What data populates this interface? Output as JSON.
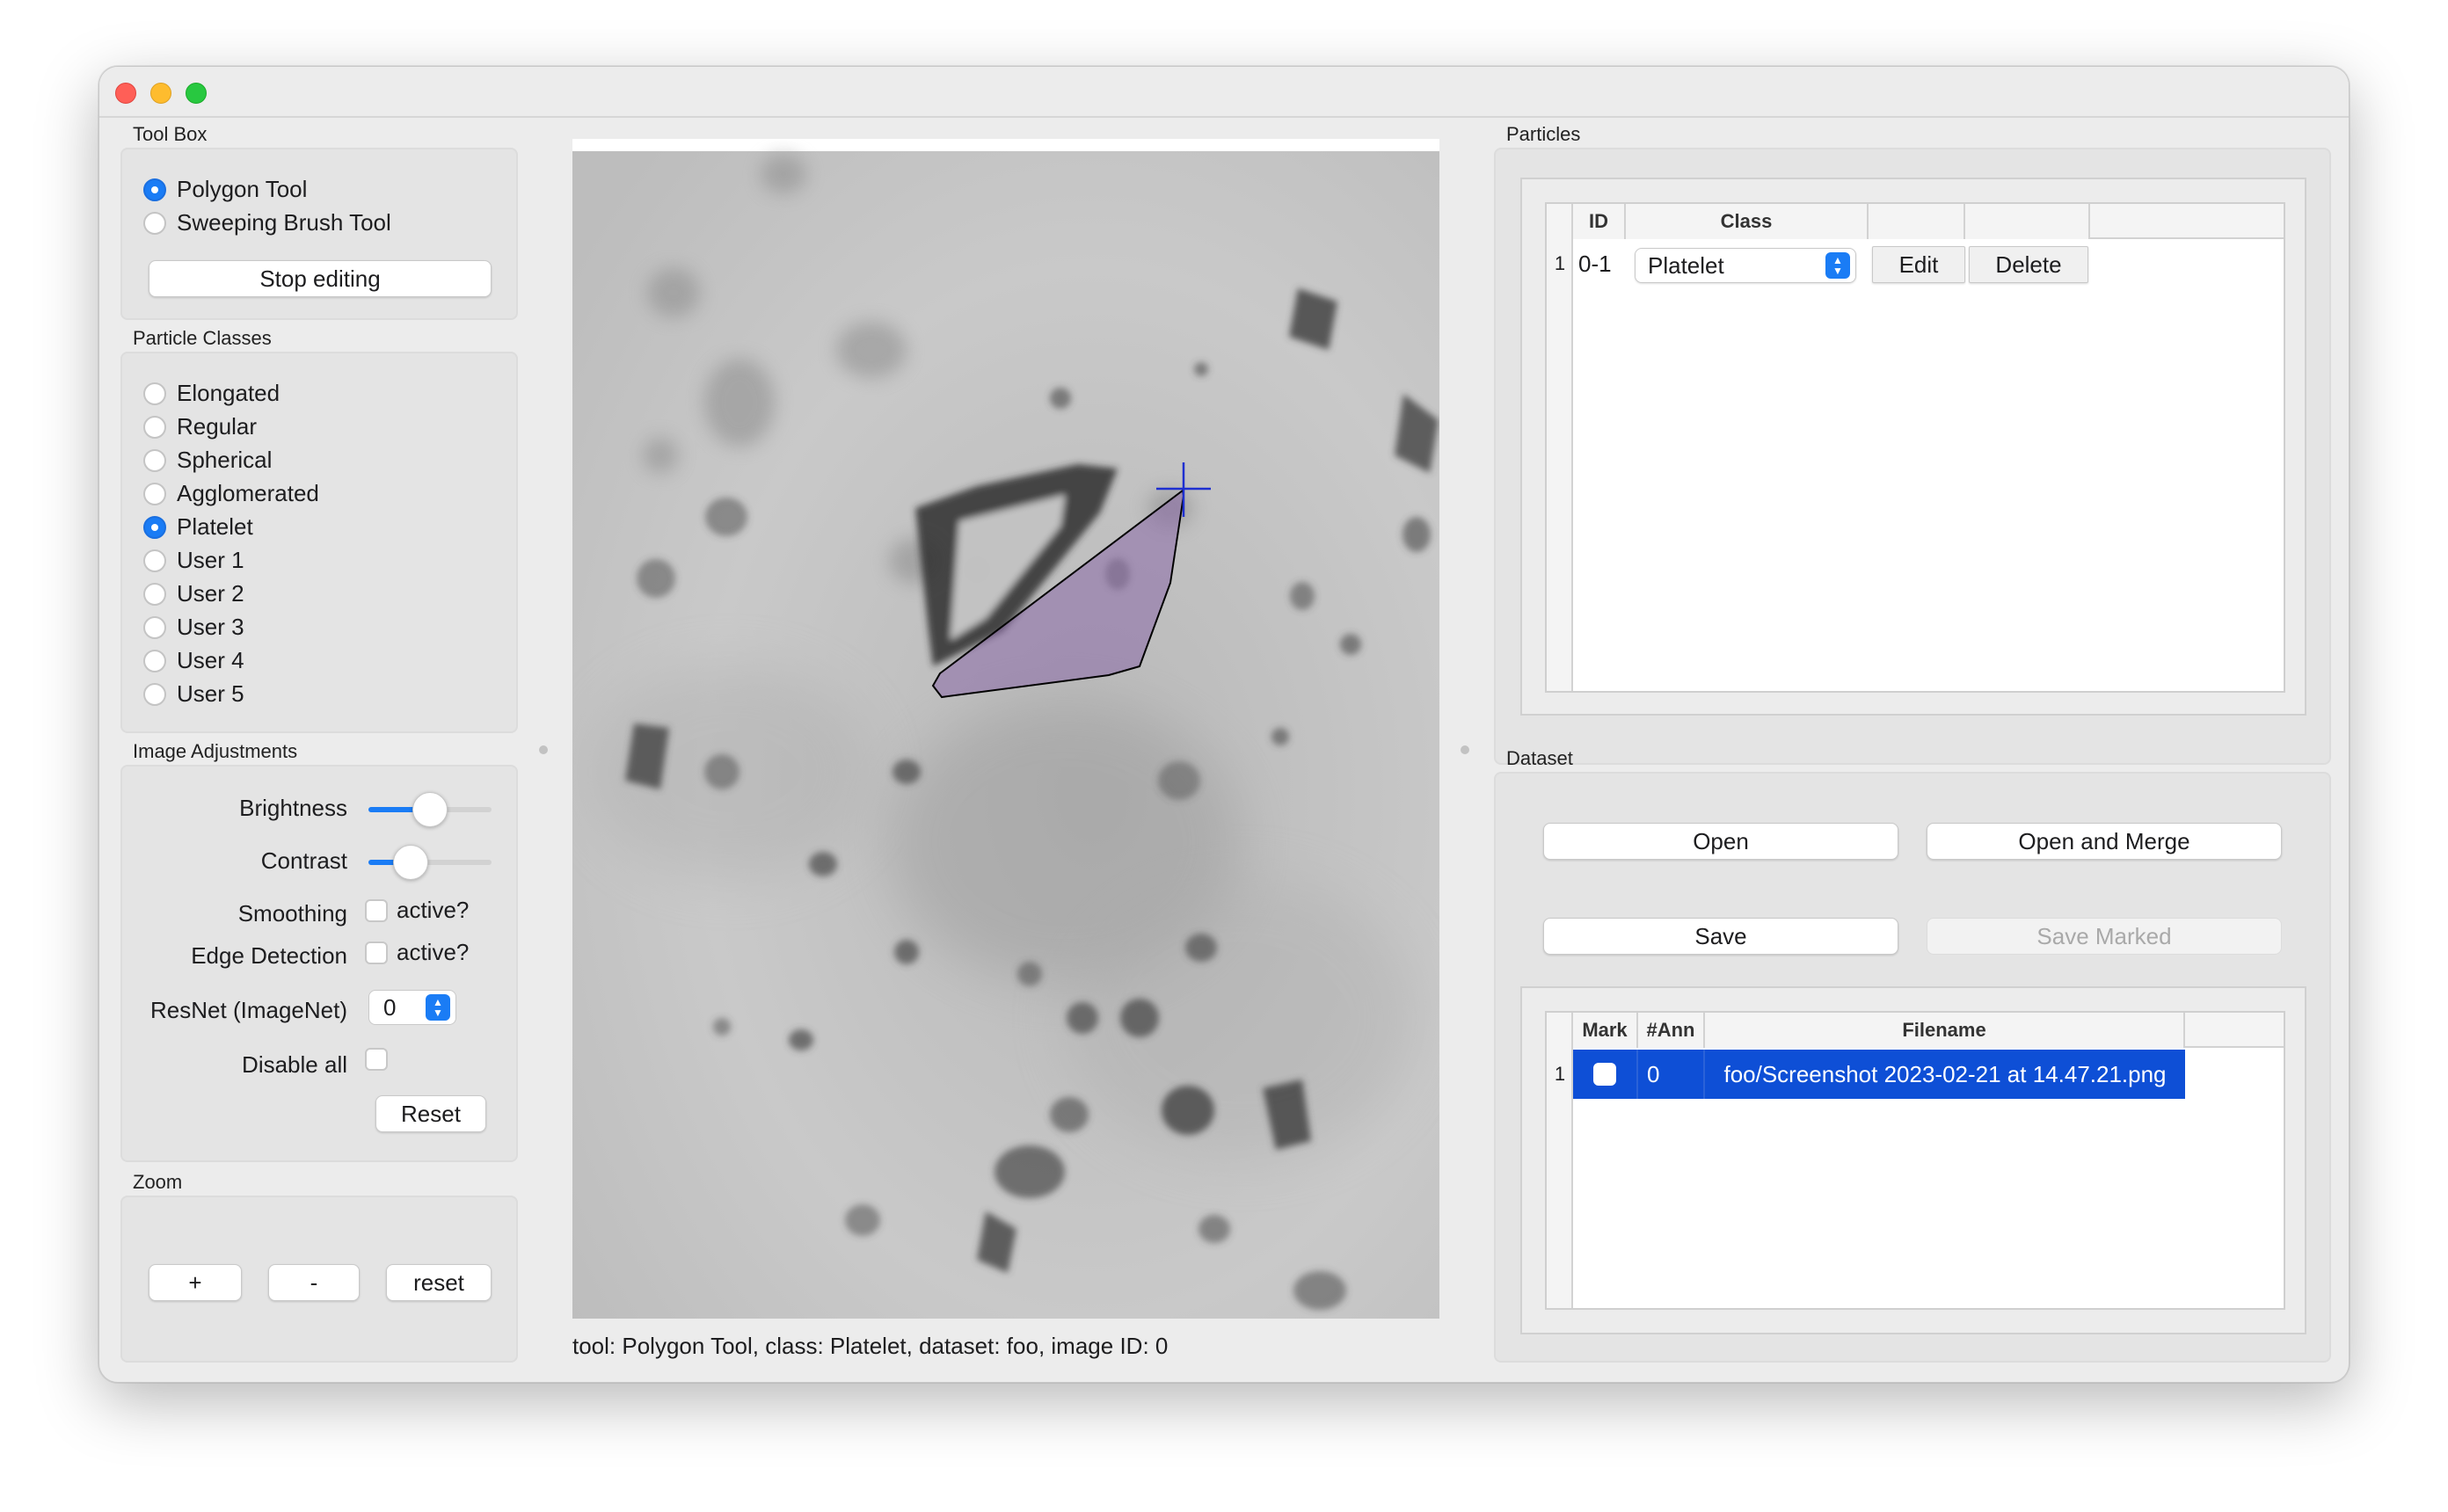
{
  "toolbox": {
    "title": "Tool Box",
    "tools": [
      "Polygon Tool",
      "Sweeping Brush Tool"
    ],
    "selected_tool_index": 0,
    "stop_editing_label": "Stop editing"
  },
  "particle_classes": {
    "title": "Particle Classes",
    "items": [
      "Elongated",
      "Regular",
      "Spherical",
      "Agglomerated",
      "Platelet",
      "User 1",
      "User 2",
      "User 3",
      "User 4",
      "User 5"
    ],
    "selected_index": 4
  },
  "image_adjustments": {
    "title": "Image Adjustments",
    "brightness_label": "Brightness",
    "brightness_level": 0.5,
    "contrast_label": "Contrast",
    "contrast_level": 0.28,
    "smoothing_label": "Smoothing",
    "smoothing_check_label": "active?",
    "edge_label": "Edge Detection",
    "edge_check_label": "active?",
    "resnet_label": "ResNet (ImageNet)",
    "resnet_value": "0",
    "disable_all_label": "Disable all",
    "reset_label": "Reset"
  },
  "zoom": {
    "title": "Zoom",
    "plus_label": "+",
    "minus_label": "-",
    "reset_label": "reset"
  },
  "status_text": "tool: Polygon Tool, class: Platelet, dataset: foo, image ID: 0",
  "particles": {
    "title": "Particles",
    "headers": {
      "id": "ID",
      "class": "Class"
    },
    "rows": [
      {
        "row": "1",
        "id": "0-1",
        "class": "Platelet",
        "edit_label": "Edit",
        "delete_label": "Delete"
      }
    ]
  },
  "dataset": {
    "title": "Dataset",
    "open_label": "Open",
    "open_merge_label": "Open and Merge",
    "save_label": "Save",
    "save_marked_label": "Save Marked",
    "headers": {
      "mark": "Mark",
      "ann": "#Ann",
      "filename": "Filename"
    },
    "rows": [
      {
        "row": "1",
        "ann": "0",
        "filename": "foo/Screenshot 2023-02-21 at 14.47.21.png"
      }
    ]
  },
  "colors": {
    "accent": "#1a7cf5",
    "selection": "#0e4fd6",
    "polygon_fill": "#8a6aa8",
    "crosshair": "#1e2fd0"
  }
}
